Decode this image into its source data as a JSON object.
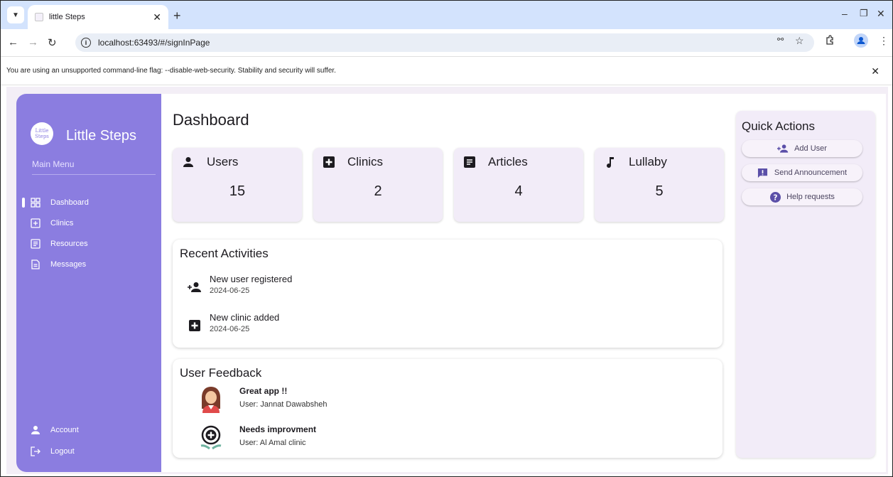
{
  "browser": {
    "tab_title": "little Steps",
    "url": "localhost:63493/#/signInPage",
    "infobar_text": "You are using an unsupported command-line flag: --disable-web-security. Stability and security will suffer."
  },
  "sidebar": {
    "logo_text": "Little Steps",
    "brand": "Little Steps",
    "menu_heading": "Main Menu",
    "items": [
      {
        "label": "Dashboard",
        "icon": "dashboard-icon"
      },
      {
        "label": "Clinics",
        "icon": "add-box-icon"
      },
      {
        "label": "Resources",
        "icon": "article-icon"
      },
      {
        "label": "Messages",
        "icon": "file-icon"
      }
    ],
    "bottom_items": [
      {
        "label": "Account",
        "icon": "person-icon"
      },
      {
        "label": "Logout",
        "icon": "logout-icon"
      }
    ]
  },
  "main": {
    "title": "Dashboard",
    "stats": [
      {
        "label": "Users",
        "value": "15",
        "icon": "person-icon"
      },
      {
        "label": "Clinics",
        "value": "2",
        "icon": "add-box-icon"
      },
      {
        "label": "Articles",
        "value": "4",
        "icon": "article-icon"
      },
      {
        "label": "Lullaby",
        "value": "5",
        "icon": "music-note-icon"
      }
    ],
    "recent": {
      "heading": "Recent Activities",
      "items": [
        {
          "title": "New user registered",
          "date": "2024-06-25",
          "icon": "person-add-icon"
        },
        {
          "title": "New clinic added",
          "date": "2024-06-25",
          "icon": "add-box-icon"
        }
      ]
    },
    "feedback": {
      "heading": "User Feedback",
      "items": [
        {
          "title": "Great app !!",
          "user": "User: Jannat Dawabsheh",
          "icon": "user-avatar-icon"
        },
        {
          "title": "Needs improvment",
          "user": "User: Al Amal clinic",
          "icon": "clinic-logo-icon"
        }
      ]
    }
  },
  "quick_actions": {
    "heading": "Quick Actions",
    "buttons": [
      {
        "label": "Add User",
        "icon": "person-add-icon"
      },
      {
        "label": "Send Announcement",
        "icon": "announcement-icon"
      },
      {
        "label": "Help requests",
        "icon": "help-icon"
      }
    ]
  },
  "colors": {
    "sidebar": "#8b7de0",
    "card": "#f2ecf8",
    "browser_tabbar": "#d3e3fd"
  }
}
